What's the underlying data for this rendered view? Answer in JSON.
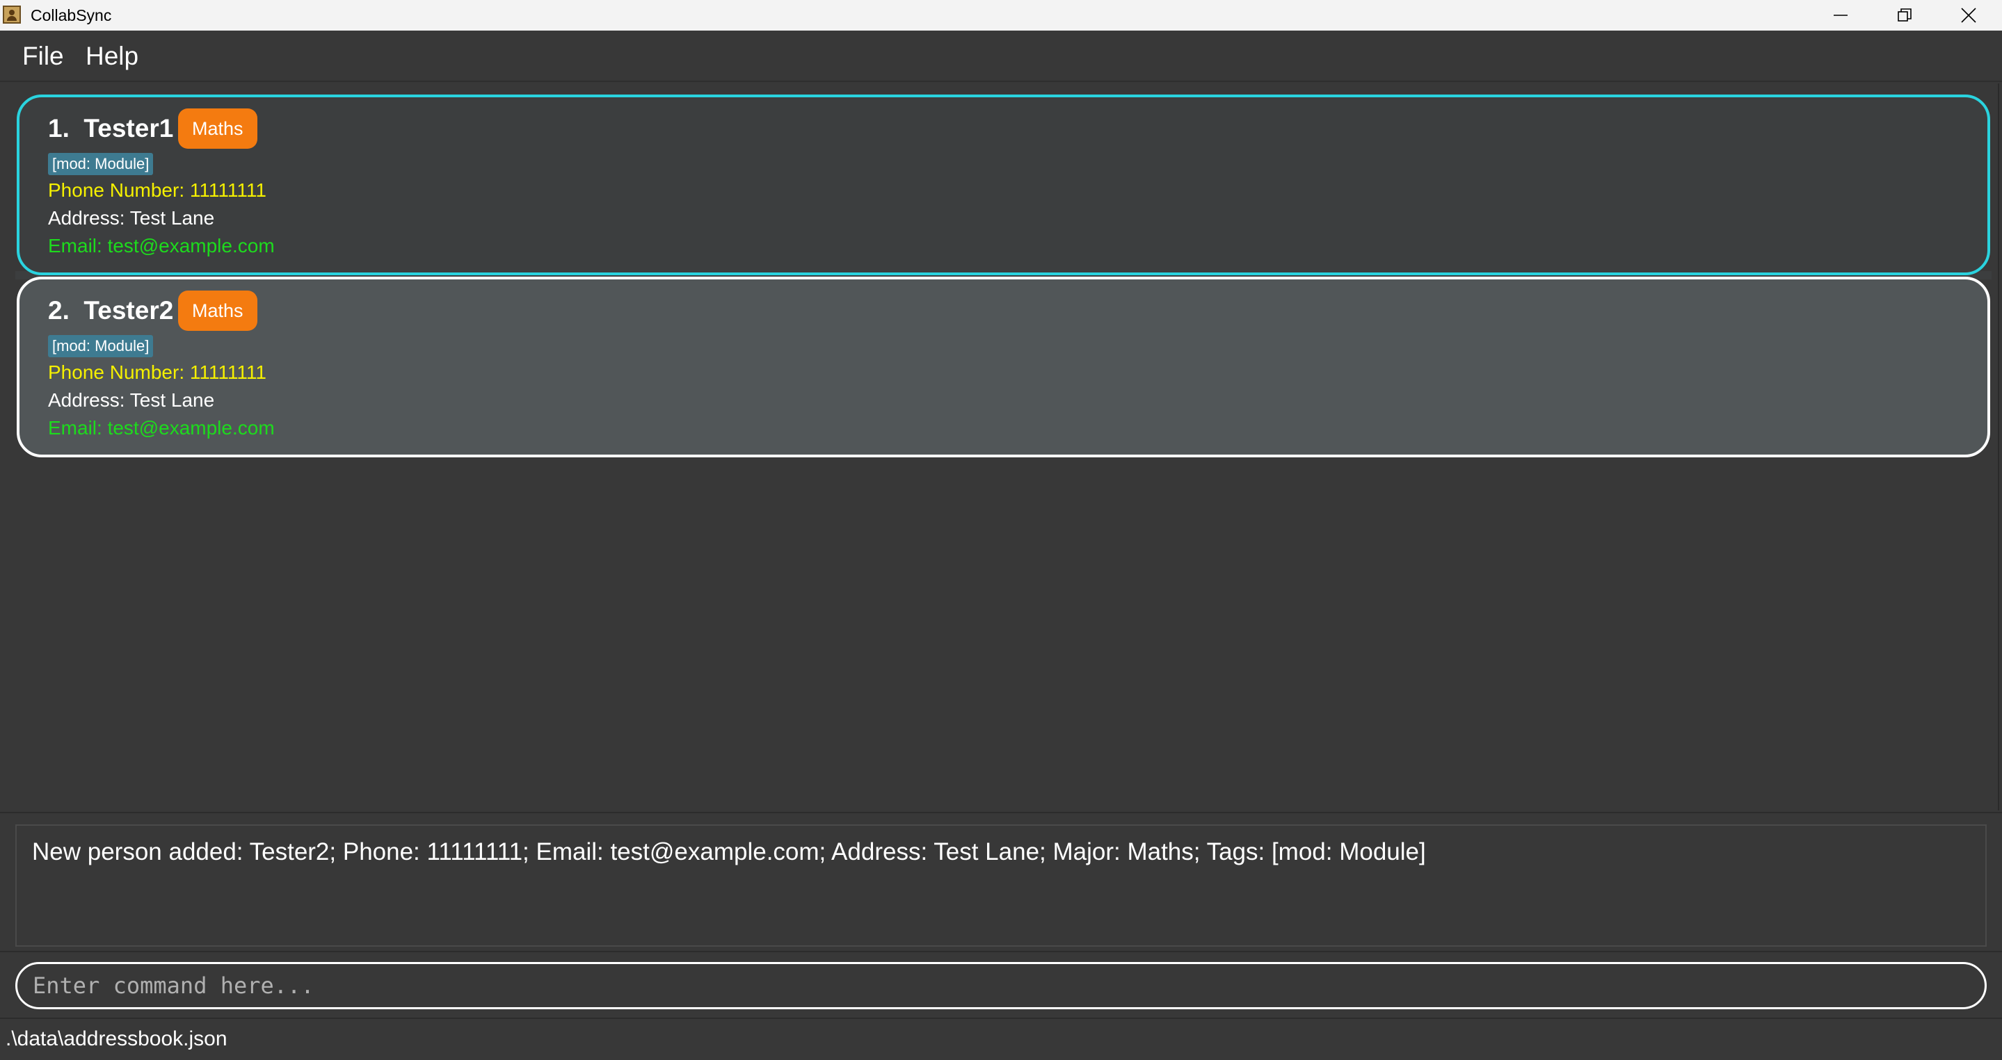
{
  "window": {
    "title": "CollabSync"
  },
  "menu": {
    "file": "File",
    "help": "Help"
  },
  "persons": [
    {
      "name": "1.  Tester1",
      "major": "Maths",
      "tag": "[mod: Module]",
      "phone": "Phone Number: 11111111",
      "address": "Address: Test Lane",
      "email": "Email: test@example.com"
    },
    {
      "name": "2.  Tester2",
      "major": "Maths",
      "tag": "[mod: Module]",
      "phone": "Phone Number: 11111111",
      "address": "Address: Test Lane",
      "email": "Email: test@example.com"
    }
  ],
  "result": {
    "text": "New person added: Tester2; Phone: 11111111; Email: test@example.com; Address: Test Lane; Major: Maths; Tags: [mod: Module]"
  },
  "command": {
    "value": "",
    "placeholder": "Enter command here..."
  },
  "status": {
    "path": ".\\data\\addressbook.json"
  },
  "colors": {
    "selected_border": "#2ad3df",
    "major_badge": "#f47b10",
    "tag_chip": "#3e7b91",
    "phone": "#f5f000",
    "email": "#1ddb1d"
  },
  "icons": {
    "app": "app-icon",
    "minimize": "minimize-icon",
    "maximize": "restore-icon",
    "close": "close-icon"
  }
}
